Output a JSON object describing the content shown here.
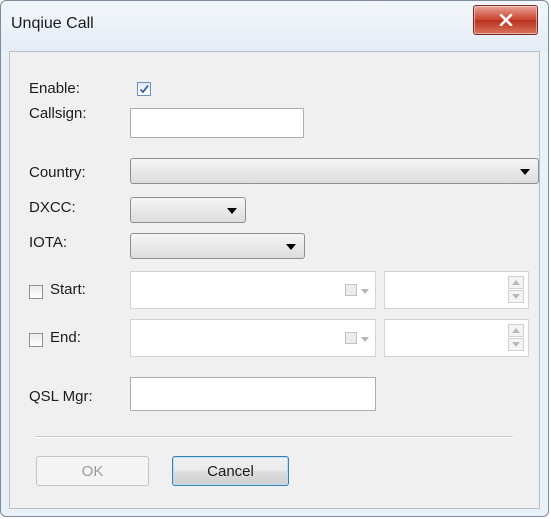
{
  "window": {
    "title": "Unqiue Call"
  },
  "fields": {
    "enable_label": "Enable:",
    "enable_checked": true,
    "callsign_label": "Callsign:",
    "callsign_value": "",
    "country_label": "Country:",
    "country_value": "",
    "dxcc_label": "DXCC:",
    "dxcc_value": "",
    "iota_label": "IOTA:",
    "iota_value": "",
    "start_label": "Start:",
    "start_checked": false,
    "end_label": "End:",
    "end_checked": false,
    "qsl_label": "QSL Mgr:",
    "qsl_value": ""
  },
  "buttons": {
    "ok": "OK",
    "cancel": "Cancel"
  }
}
